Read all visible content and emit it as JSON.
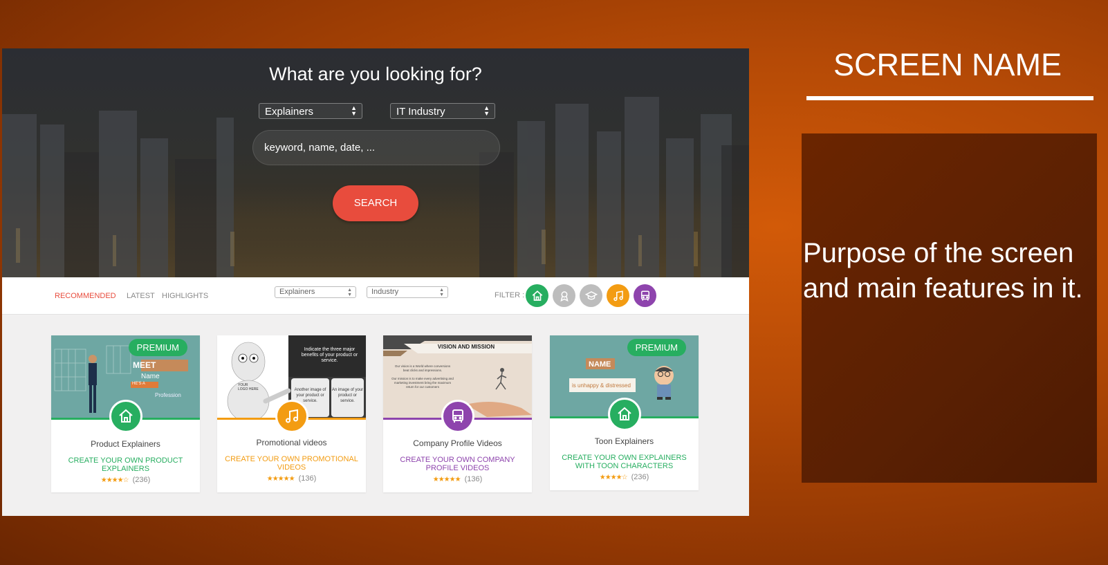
{
  "hero": {
    "title": "What are you looking for?",
    "category_select": "Explainers",
    "industry_select": "IT Industry",
    "search_placeholder": "keyword, name, date, ...",
    "search_button": "SEARCH"
  },
  "filterbar": {
    "tabs": [
      {
        "label": "RECOMMENDED",
        "active": true
      },
      {
        "label": "LATEST",
        "active": false
      },
      {
        "label": "HIGHLIGHTS",
        "active": false
      }
    ],
    "category_select": "Explainers",
    "industry_select": "Industry",
    "filter_label": "FILTER :",
    "filter_icons": [
      {
        "icon": "home-icon",
        "color": "#27ae60"
      },
      {
        "icon": "award-icon",
        "color": "#bdbdbd"
      },
      {
        "icon": "graduation-cap-icon",
        "color": "#bdbdbd"
      },
      {
        "icon": "music-icon",
        "color": "#f39c12"
      },
      {
        "icon": "bus-icon",
        "color": "#8e44ad"
      }
    ]
  },
  "cards": [
    {
      "name": "Product Explainers",
      "cta": "CREATE YOUR OWN PRODUCT EXPLAINERS",
      "stars": "★★★★☆",
      "count": "(236)",
      "premium": "PREMIUM",
      "color": "#27ae60",
      "icon": "home-icon",
      "thumb": {
        "meet": "MEET",
        "name": "Name",
        "hes": "HE'S A",
        "profession": "Profession"
      }
    },
    {
      "name": "Promotional videos",
      "cta": "CREATE YOUR OWN PROMOTIONAL VIDEOS",
      "stars": "★★★★★",
      "count": "(136)",
      "premium": "",
      "color": "#f39c12",
      "icon": "music-icon",
      "thumb": {
        "logo": "YOUR LOGO HERE",
        "indicate": "Indicate the three major benefits of your product or service.",
        "another": "Another image of your product or service.",
        "an_image": "An image of your product or service."
      }
    },
    {
      "name": "Company Profile Videos",
      "cta": "CREATE YOUR OWN COMPANY PROFILE VIDEOS",
      "stars": "★★★★★",
      "count": "(136)",
      "premium": "",
      "color": "#8e44ad",
      "icon": "bus-icon",
      "thumb": {
        "heading": "VISION AND MISSION",
        "vision": "Our vision is a World where conversions beat clicks and impressions.",
        "mission": "Our mission is to make every advertising and marketing investment bring the maximum return for our customers"
      }
    },
    {
      "name": "Toon Explainers",
      "cta": "CREATE YOUR OWN EXPLAINERS WITH TOON CHARACTERS",
      "stars": "★★★★☆",
      "count": "(236)",
      "premium": "PREMIUM",
      "color": "#27ae60",
      "icon": "home-icon",
      "thumb": {
        "name": "NAME",
        "status": "is unhappy & distressed"
      }
    }
  ],
  "side": {
    "title": "SCREEN NAME",
    "description": "Purpose of the screen and main features in it."
  }
}
